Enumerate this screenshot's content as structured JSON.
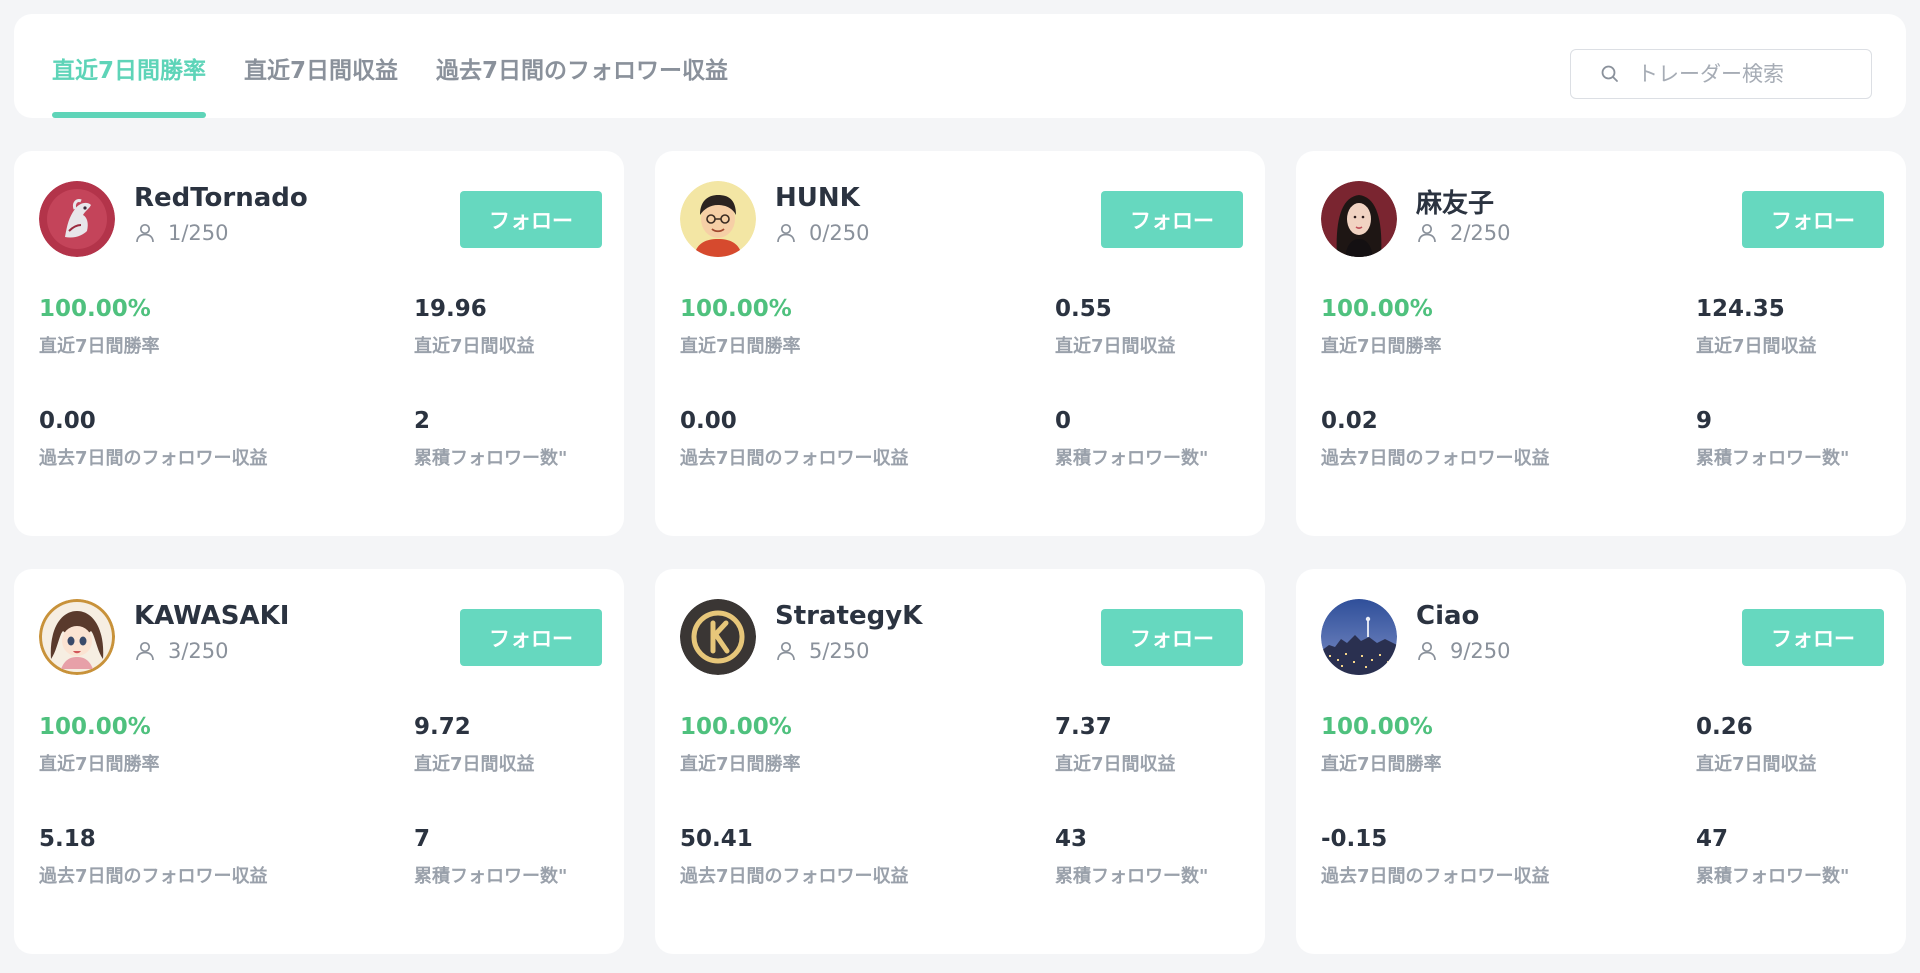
{
  "tabs": [
    {
      "label": "直近7日間勝率",
      "active": true
    },
    {
      "label": "直近7日間収益",
      "active": false
    },
    {
      "label": "過去7日間のフォロワー収益",
      "active": false
    }
  ],
  "search": {
    "placeholder": "トレーダー検索",
    "value": ""
  },
  "colors": {
    "accent": "#5ed4b8",
    "button": "#66d8bf",
    "positive": "#4fc17e"
  },
  "stat_labels": {
    "win_rate": "直近7日間勝率",
    "profit": "直近7日間収益",
    "follower_profit": "過去7日間のフォロワー収益",
    "total_followers": "累積フォロワー数\""
  },
  "follow_label": "フォロー",
  "traders": [
    {
      "name": "RedTornado",
      "followers": "1/250",
      "win_rate": "100.00%",
      "profit": "19.96",
      "follower_profit": "0.00",
      "total_followers": "2",
      "avatar": "horse-avatar"
    },
    {
      "name": "HUNK",
      "followers": "0/250",
      "win_rate": "100.00%",
      "profit": "0.55",
      "follower_profit": "0.00",
      "total_followers": "0",
      "avatar": "cartoon-man-avatar"
    },
    {
      "name": "麻友子",
      "followers": "2/250",
      "win_rate": "100.00%",
      "profit": "124.35",
      "follower_profit": "0.02",
      "total_followers": "9",
      "avatar": "woman-photo-avatar"
    },
    {
      "name": "KAWASAKI",
      "followers": "3/250",
      "win_rate": "100.00%",
      "profit": "9.72",
      "follower_profit": "5.18",
      "total_followers": "7",
      "avatar": "anime-girl-avatar"
    },
    {
      "name": "StrategyK",
      "followers": "5/250",
      "win_rate": "100.00%",
      "profit": "7.37",
      "follower_profit": "50.41",
      "total_followers": "43",
      "avatar": "k-logo-avatar"
    },
    {
      "name": "Ciao",
      "followers": "9/250",
      "win_rate": "100.00%",
      "profit": "0.26",
      "follower_profit": "-0.15",
      "total_followers": "47",
      "avatar": "city-night-avatar"
    }
  ]
}
